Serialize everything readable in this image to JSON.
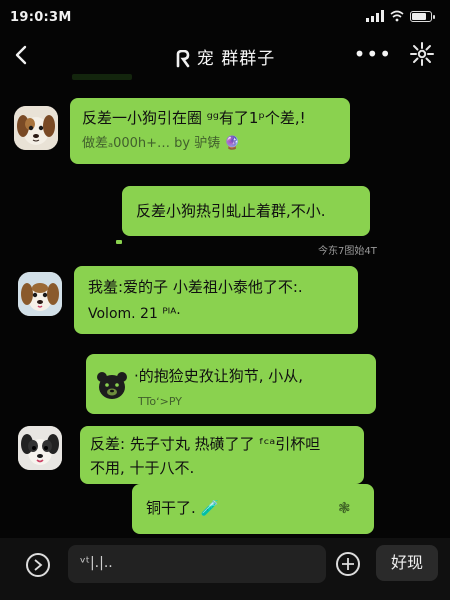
{
  "status_bar": {
    "time": "19:0:3M"
  },
  "header": {
    "title": "宠 群群子",
    "more_label": "•••"
  },
  "messages": [
    {
      "line1": "反差一小狗引在圈 ᵍᵍ有了1ᵖ个差,!",
      "line2": "做差ₐ000h+… by 驴铸 🔮"
    },
    {
      "line1": "反差小狗热引虬止着群,不小."
    },
    {
      "timestamp": "今东7图始4T"
    },
    {
      "line1": "我羞:爱的子  小差祖小泰他了不:.",
      "line2": "Volom. 21 ᴾᴵᴬ·"
    },
    {
      "line1": "·的抱猃史孜让狗节, 小从,",
      "line2": "TToʻ>PY"
    },
    {
      "line1": "反差: 先子寸丸 热磺了了 ᶠᶜᵃ引杯呾",
      "line2": "不用, 十于八不."
    },
    {
      "line1": "铜干了. 🧪",
      "line2": "❃"
    }
  ],
  "input": {
    "value": "ᵛᵗ|.|.."
  },
  "send_button": {
    "label": "好现"
  }
}
